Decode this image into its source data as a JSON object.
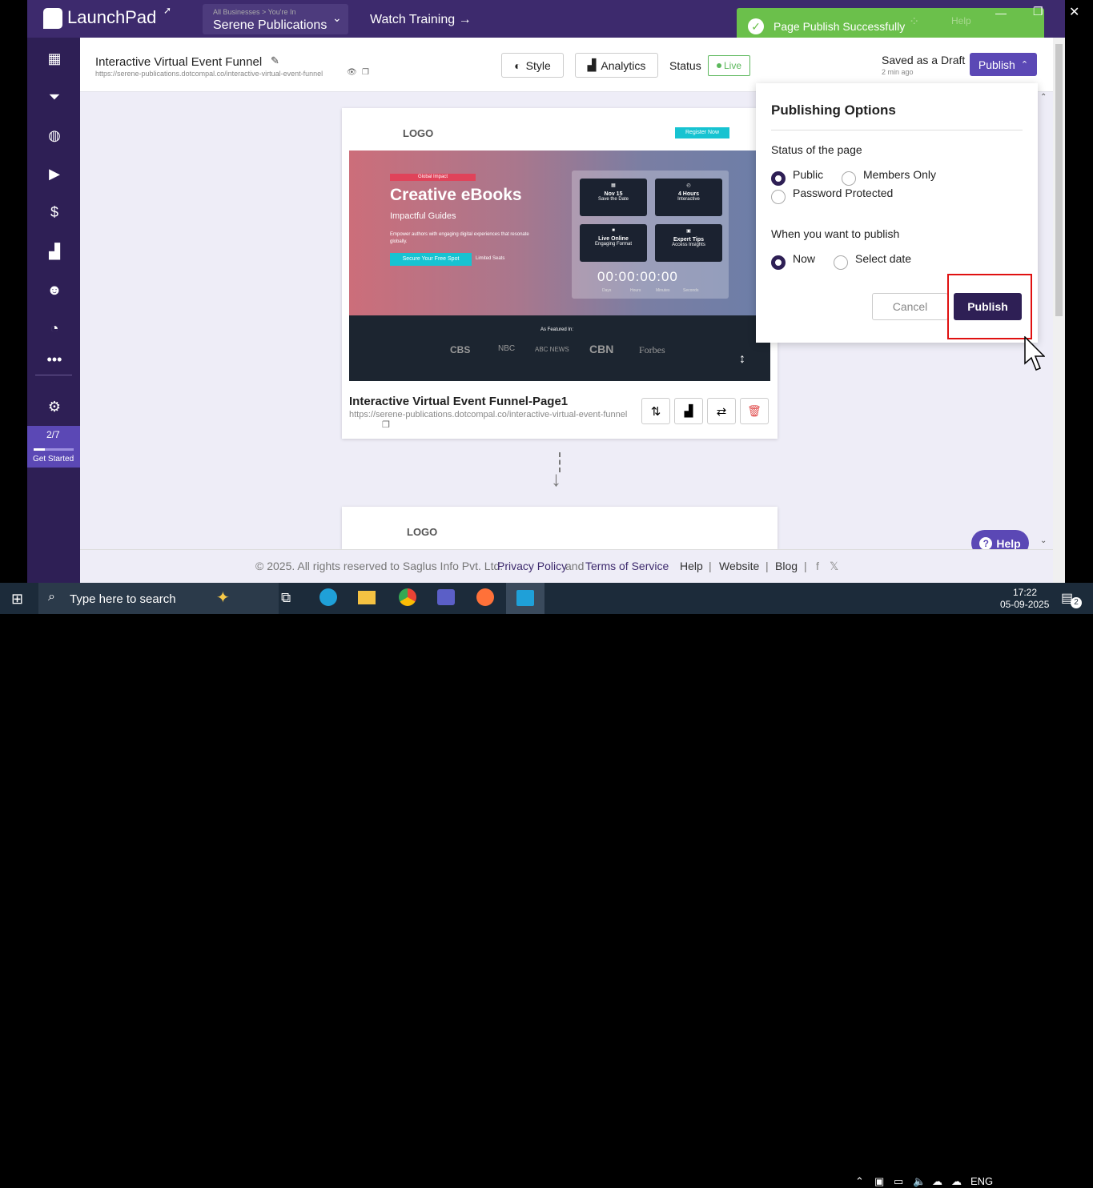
{
  "topbar": {
    "brand": "LaunchPad",
    "biz_small": "All Businesses > You're In",
    "biz_name": "Serene Publications",
    "training": "Watch Training →",
    "toast": "Page Publish Successfully",
    "help": "Help"
  },
  "sidebar": {
    "icons": [
      "dashboard-icon",
      "funnel-icon",
      "globe-icon",
      "video-icon",
      "dollar-icon",
      "analytics-icon",
      "users-icon",
      "gauge-icon",
      "more-icon",
      "settings-icon"
    ],
    "progress": "2/7",
    "progress_value": 0.2857,
    "get_started": "Get Started"
  },
  "header": {
    "title": "Interactive Virtual Event Funnel",
    "url": "https://serene-publications.dotcompal.co/interactive-virtual-event-funnel",
    "style_label": "Style",
    "analytics_label": "Analytics",
    "status_label": "Status",
    "status_value": "Live",
    "saved": "Saved as a Draft",
    "saved_time": "2 min ago",
    "publish_label": "Publish"
  },
  "preview": {
    "logo": "LOGO",
    "register": "Register Now",
    "badge": "Global Impact",
    "headline": "Creative eBooks",
    "subhead": "Impactful Guides",
    "body": "Empower authors with engaging digital experiences that resonate globally.",
    "cta": "Secure Your Free Spot",
    "seats": "Limited Seats",
    "tiles": [
      {
        "a": "Nov 15",
        "b": "Save the Date"
      },
      {
        "a": "4 Hours",
        "b": "Interactive"
      },
      {
        "a": "Live Online",
        "b": "Engaging Format"
      },
      {
        "a": "Expert Tips",
        "b": "Access Insights"
      }
    ],
    "countdown": [
      "00",
      "00",
      "00",
      "00"
    ],
    "count_labels": [
      "Days",
      "Hours",
      "Minutes",
      "Seconds"
    ],
    "featured": "As Featured In:",
    "brands": [
      "CBS",
      "NBC",
      "ABC NEWS",
      "CBN",
      "Forbes"
    ]
  },
  "page1": {
    "title": "Interactive Virtual Event Funnel-Page1",
    "url": "https://serene-publications.dotcompal.co/interactive-virtual-event-funnel"
  },
  "page2": {
    "logo": "LOGO"
  },
  "popup": {
    "title": "Publishing Options",
    "status_heading": "Status of the page",
    "opt_public": "Public",
    "opt_members": "Members Only",
    "opt_password": "Password Protected",
    "when_heading": "When you want to publish",
    "opt_now": "Now",
    "opt_date": "Select date",
    "cancel": "Cancel",
    "publish": "Publish"
  },
  "footer": {
    "copyright": "©  2025. All rights reserved to Saglus Info Pvt. Ltd.",
    "privacy": "Privacy Policy",
    "and": "and",
    "terms": "Terms of Service",
    "help": "Help",
    "website": "Website",
    "blog": "Blog"
  },
  "help_button": "Help",
  "taskbar": {
    "search": "Type here to search",
    "lang": "ENG",
    "time": "17:22",
    "date": "05-09-2025",
    "notif": "2"
  }
}
